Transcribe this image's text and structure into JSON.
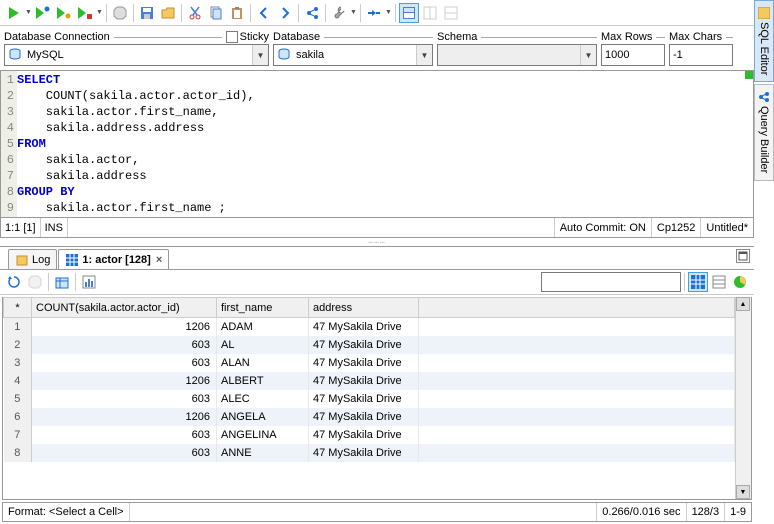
{
  "toolbar": {
    "run": "Run",
    "run_current": "Run Current",
    "run_script": "Run Script"
  },
  "conn": {
    "label": "Database Connection",
    "sticky_label": "Sticky",
    "database_label": "Database",
    "schema_label": "Schema",
    "max_rows_label": "Max Rows",
    "max_chars_label": "Max Chars",
    "connection_value": "MySQL",
    "database_value": "sakila",
    "schema_value": "",
    "max_rows_value": "1000",
    "max_chars_value": "-1"
  },
  "sql": {
    "lines": [
      {
        "n": "1",
        "pre": "",
        "kw": "SELECT",
        "post": ""
      },
      {
        "n": "2",
        "pre": "    ",
        "kw": "",
        "post": "COUNT(sakila.actor.actor_id),"
      },
      {
        "n": "3",
        "pre": "    ",
        "kw": "",
        "post": "sakila.actor.first_name,"
      },
      {
        "n": "4",
        "pre": "    ",
        "kw": "",
        "post": "sakila.address.address"
      },
      {
        "n": "5",
        "pre": "",
        "kw": "FROM",
        "post": ""
      },
      {
        "n": "6",
        "pre": "    ",
        "kw": "",
        "post": "sakila.actor,"
      },
      {
        "n": "7",
        "pre": "    ",
        "kw": "",
        "post": "sakila.address"
      },
      {
        "n": "8",
        "pre": "",
        "kw": "GROUP BY",
        "post": ""
      },
      {
        "n": "9",
        "pre": "    ",
        "kw": "",
        "post": "sakila.actor.first_name ;"
      }
    ]
  },
  "editor_status": {
    "pos": "1:1 [1]",
    "mode": "INS",
    "auto_commit": "Auto Commit: ON",
    "encoding": "Cp1252",
    "file": "Untitled*"
  },
  "tabs": {
    "log": "Log",
    "result": "1: actor [128]"
  },
  "table": {
    "headers": {
      "rownum": "*",
      "c1": "COUNT(sakila.actor.actor_id)",
      "c2": "first_name",
      "c3": "address"
    },
    "rows": [
      {
        "n": "1",
        "c1": "1206",
        "c2": "ADAM",
        "c3": "47 MySakila Drive"
      },
      {
        "n": "2",
        "c1": "603",
        "c2": "AL",
        "c3": "47 MySakila Drive"
      },
      {
        "n": "3",
        "c1": "603",
        "c2": "ALAN",
        "c3": "47 MySakila Drive"
      },
      {
        "n": "4",
        "c1": "1206",
        "c2": "ALBERT",
        "c3": "47 MySakila Drive"
      },
      {
        "n": "5",
        "c1": "603",
        "c2": "ALEC",
        "c3": "47 MySakila Drive"
      },
      {
        "n": "6",
        "c1": "1206",
        "c2": "ANGELA",
        "c3": "47 MySakila Drive"
      },
      {
        "n": "7",
        "c1": "603",
        "c2": "ANGELINA",
        "c3": "47 MySakila Drive"
      },
      {
        "n": "8",
        "c1": "603",
        "c2": "ANNE",
        "c3": "47 MySakila Drive"
      }
    ]
  },
  "bottom": {
    "format": "Format: <Select a Cell>",
    "timing": "0.266/0.016 sec",
    "rows_info": "128/3",
    "range": "1-9"
  },
  "side": {
    "editor": "SQL Editor",
    "builder": "Query Builder"
  }
}
